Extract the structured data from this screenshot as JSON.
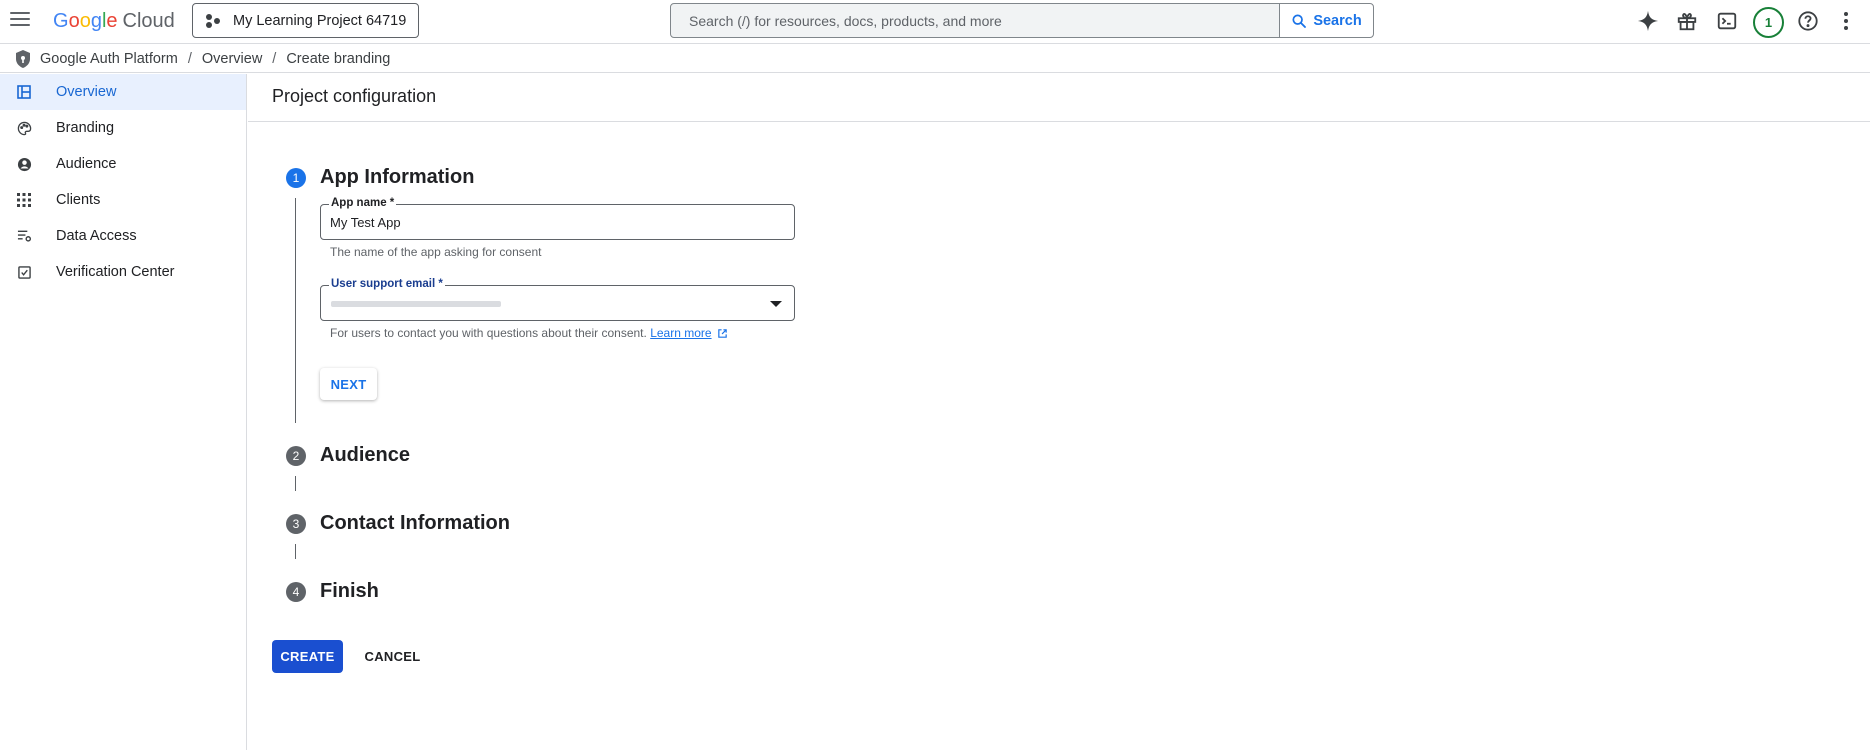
{
  "header": {
    "logo_google": [
      "G",
      "o",
      "o",
      "g",
      "l",
      "e"
    ],
    "logo_cloud": "Cloud",
    "project_name": "My Learning Project 64719",
    "search_placeholder": "Search (/) for resources, docs, products, and more",
    "search_button": "Search",
    "notification_count": "1"
  },
  "breadcrumb": {
    "items": [
      "Google Auth Platform",
      "Overview",
      "Create branding"
    ],
    "separator": "/"
  },
  "sidebar": {
    "items": [
      {
        "label": "Overview",
        "icon": "dashboard-icon",
        "active": true
      },
      {
        "label": "Branding",
        "icon": "palette-icon",
        "active": false
      },
      {
        "label": "Audience",
        "icon": "account-circle-icon",
        "active": false
      },
      {
        "label": "Clients",
        "icon": "apps-grid-icon",
        "active": false
      },
      {
        "label": "Data Access",
        "icon": "list-settings-icon",
        "active": false
      },
      {
        "label": "Verification Center",
        "icon": "checkbox-icon",
        "active": false
      }
    ]
  },
  "main": {
    "title": "Project configuration",
    "steps": [
      {
        "number": "1",
        "title": "App Information"
      },
      {
        "number": "2",
        "title": "Audience"
      },
      {
        "number": "3",
        "title": "Contact Information"
      },
      {
        "number": "4",
        "title": "Finish"
      }
    ],
    "app_name": {
      "label": "App name *",
      "value": "My Test App",
      "helper": "The name of the app asking for consent"
    },
    "support_email": {
      "label": "User support email *",
      "helper": "For users to contact you with questions about their consent.",
      "learn_more": "Learn more"
    },
    "next_label": "NEXT",
    "create_label": "CREATE",
    "cancel_label": "CANCEL"
  },
  "colors": {
    "accent": "#1a73e8",
    "primary_button": "#1a4fd0",
    "active_nav_bg": "#e8f0fe",
    "notification_ring": "#188038"
  }
}
